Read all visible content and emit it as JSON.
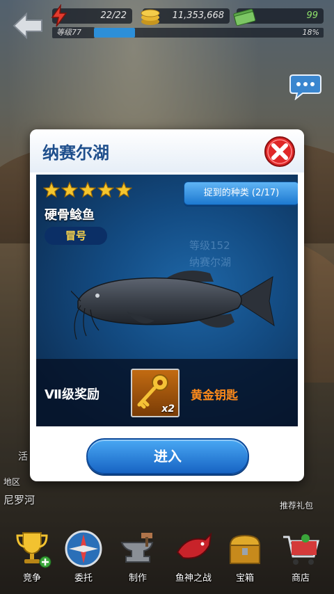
{
  "hud": {
    "energy": "22/22",
    "coins": "11,353,668",
    "cash": "99",
    "level_label": "等级77",
    "level_progress": 0.18,
    "level_percent": "18%"
  },
  "side": {
    "event_label": "活",
    "region_heading": "地区",
    "region_name": "尼罗河",
    "gift_label": "推荐礼包"
  },
  "dialog": {
    "title": "纳赛尔湖",
    "stars": 5,
    "caught_button": "捉到的种类 (2/17)",
    "fish_name": "硬骨鲶鱼",
    "fish_tag": "冒号",
    "watermark_line1": "等级152",
    "watermark_line2": "纳赛尔湖",
    "reward_label": "Ⅶ级奖励",
    "reward_item": "黄金钥匙",
    "reward_qty": "x2",
    "enter_button": "进入"
  },
  "nav": [
    {
      "label": "竞争",
      "icon": "trophy-icon"
    },
    {
      "label": "委托",
      "icon": "compass-icon"
    },
    {
      "label": "制作",
      "icon": "anvil-icon"
    },
    {
      "label": "鱼神之战",
      "icon": "fish-god-icon"
    },
    {
      "label": "宝箱",
      "icon": "treasure-chest-icon"
    },
    {
      "label": "商店",
      "icon": "shop-cart-icon"
    }
  ],
  "colors": {
    "title_blue": "#1f4f8c",
    "reward_orange": "#ff8a1a",
    "tag_yellow": "#ffd84a",
    "cash_green": "#8fe36b"
  }
}
